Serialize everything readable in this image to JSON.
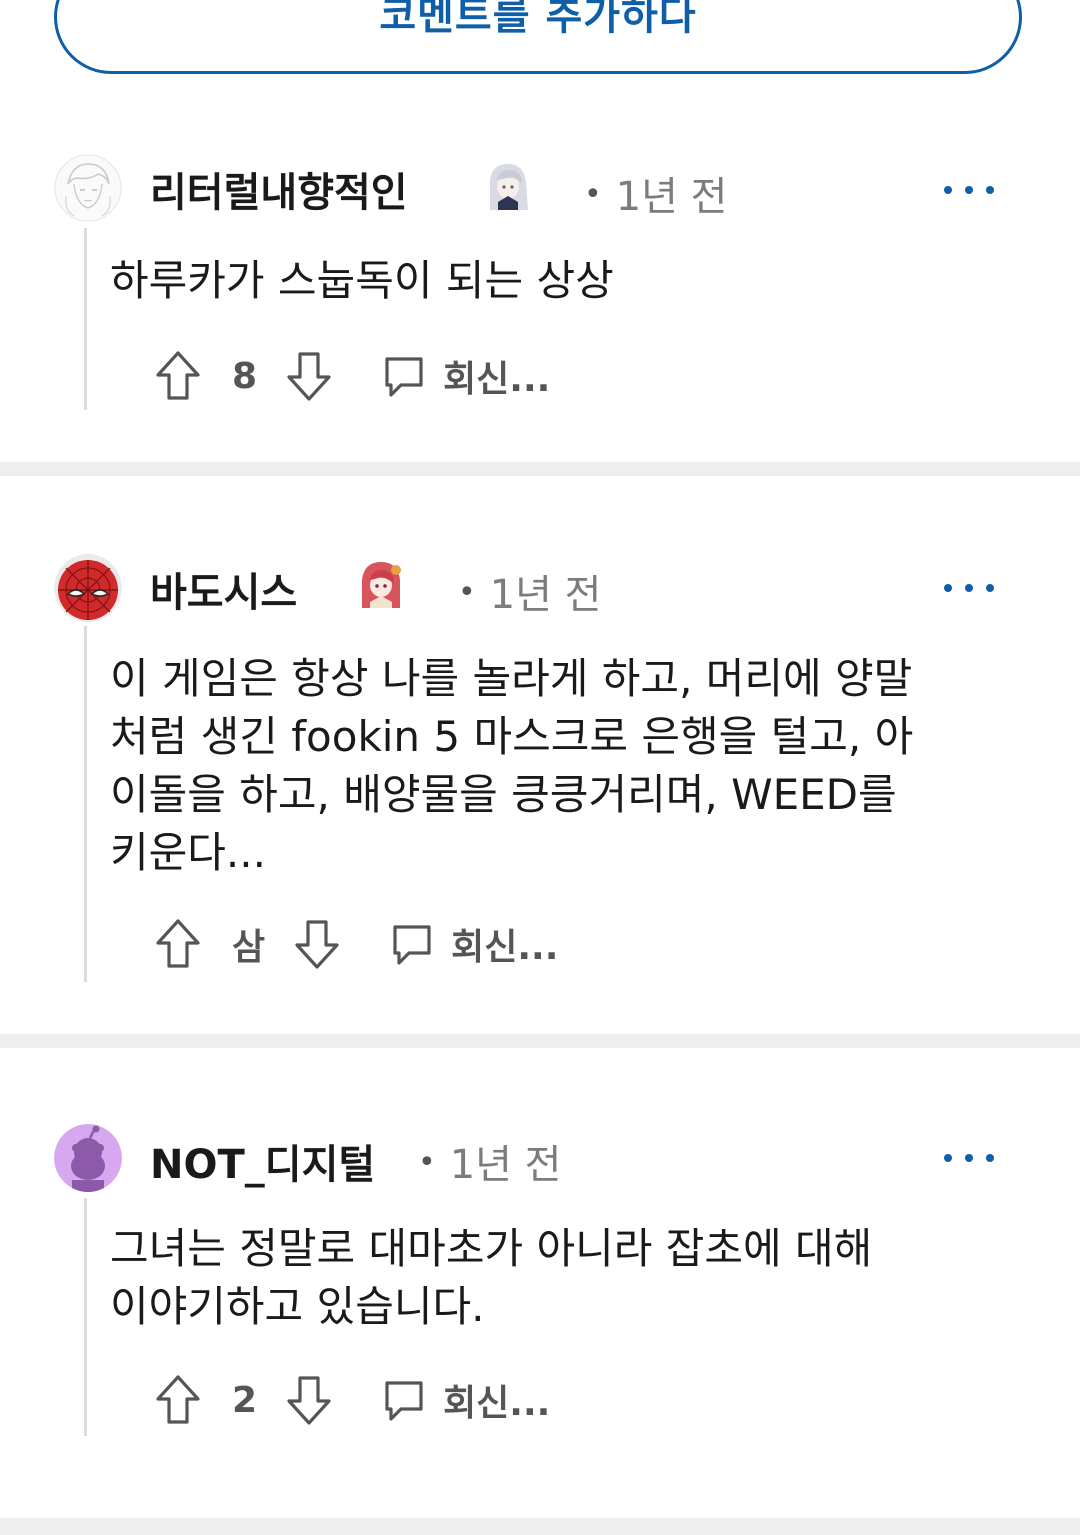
{
  "add_comment_label": "코멘트를 추가하다",
  "comments": [
    {
      "username": "리터럴내향적인",
      "time": "1년 전",
      "dot": "•",
      "body": "하루카가 스눕독이 되는 상상",
      "votes": "8",
      "reply_label": "회신..."
    },
    {
      "username": "바도시스",
      "time": "1년 전",
      "dot": "•",
      "body": "이 게임은 항상 나를 놀라게 하고, 머리에 양말\n처럼 생긴 fookin 5 마스크로 은행을 털고, 아\n이돌을 하고, 배양물을 킁킁거리며, WEED를\n키운다...",
      "votes": "삼",
      "reply_label": "회신..."
    },
    {
      "username": "NOT_디지털",
      "time": "1년 전",
      "dot": "•",
      "body": "그녀는 정말로 대마초가 아니라 잡초에 대해\n이야기하고 있습니다.",
      "votes": "2",
      "reply_label": "회신..."
    }
  ],
  "colors": {
    "accent": "#0e5ea8",
    "muted_text": "#7c7c7c",
    "divider": "#eeeeee",
    "thread_line": "#dcdcdc"
  },
  "icons": [
    "upvote-icon",
    "downvote-icon",
    "reply-bubble-icon",
    "more-options-icon"
  ]
}
